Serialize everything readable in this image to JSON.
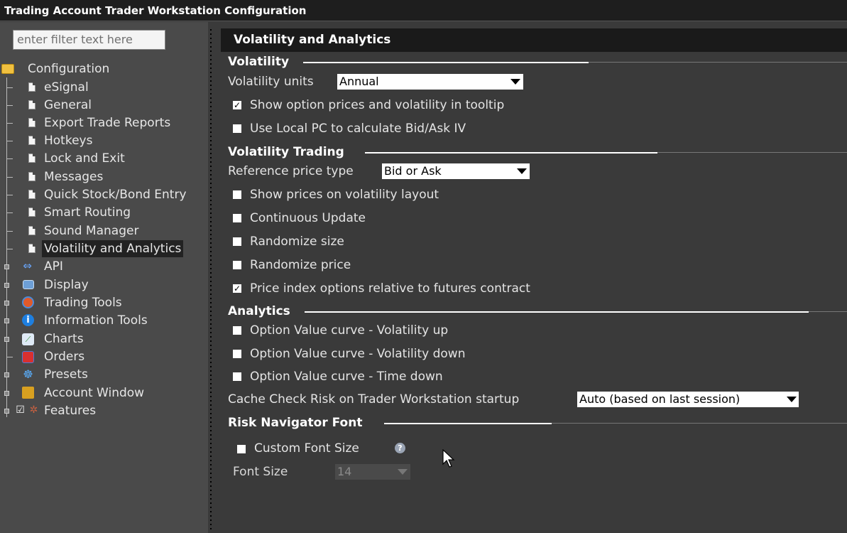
{
  "window": {
    "title": "Trading Account Trader Workstation Configuration"
  },
  "filter": {
    "placeholder": "enter filter text here"
  },
  "tree": {
    "root": "Configuration",
    "children": [
      {
        "label": "eSignal",
        "icon": "document-icon"
      },
      {
        "label": "General",
        "icon": "document-icon"
      },
      {
        "label": "Export Trade Reports",
        "icon": "document-icon"
      },
      {
        "label": "Hotkeys",
        "icon": "document-icon"
      },
      {
        "label": "Lock and Exit",
        "icon": "document-icon"
      },
      {
        "label": "Messages",
        "icon": "document-icon"
      },
      {
        "label": "Quick Stock/Bond Entry",
        "icon": "document-icon"
      },
      {
        "label": "Smart Routing",
        "icon": "document-icon"
      },
      {
        "label": "Sound Manager",
        "icon": "document-icon"
      },
      {
        "label": "Volatility and Analytics",
        "icon": "document-icon",
        "selected": true
      }
    ],
    "groups": [
      {
        "label": "API",
        "icon": "api-arrows-icon"
      },
      {
        "label": "Display",
        "icon": "display-icon"
      },
      {
        "label": "Trading Tools",
        "icon": "trading-tools-icon"
      },
      {
        "label": "Information Tools",
        "icon": "info-icon"
      },
      {
        "label": "Charts",
        "icon": "chart-icon"
      },
      {
        "label": "Orders",
        "icon": "orders-icon"
      },
      {
        "label": "Presets",
        "icon": "presets-icon"
      },
      {
        "label": "Account Window",
        "icon": "account-icon"
      },
      {
        "label": "Features",
        "icon": "features-icon"
      }
    ]
  },
  "panel": {
    "title": "Volatility and Analytics",
    "volatility": {
      "heading": "Volatility",
      "units_label": "Volatility units",
      "units_value": "Annual",
      "show_tooltip": {
        "label": "Show option prices and volatility in tooltip",
        "checked": true
      },
      "local_pc": {
        "label": "Use Local PC to calculate Bid/Ask IV",
        "checked": false
      }
    },
    "volatility_trading": {
      "heading": "Volatility Trading",
      "ref_label": "Reference price type",
      "ref_value": "Bid or Ask",
      "options": [
        {
          "label": "Show prices on volatility layout",
          "checked": false
        },
        {
          "label": "Continuous Update",
          "checked": false
        },
        {
          "label": "Randomize size",
          "checked": false
        },
        {
          "label": "Randomize price",
          "checked": false
        },
        {
          "label": "Price index options relative to futures contract",
          "checked": true
        }
      ]
    },
    "analytics": {
      "heading": "Analytics",
      "options": [
        {
          "label": "Option Value curve - Volatility up",
          "checked": false
        },
        {
          "label": "Option Value curve - Volatility down",
          "checked": false
        },
        {
          "label": "Option Value curve - Time down",
          "checked": false
        }
      ],
      "cache_label": "Cache Check Risk on Trader Workstation startup",
      "cache_value": "Auto (based on last session)"
    },
    "risk_font": {
      "heading": "Risk Navigator Font",
      "custom_label": "Custom Font Size",
      "custom_checked": false,
      "size_label": "Font Size",
      "size_value": "14"
    }
  },
  "colors": {
    "background": "#3a3a3a",
    "header": "#1a1a1a",
    "sidebar": "#4a4a4a"
  }
}
